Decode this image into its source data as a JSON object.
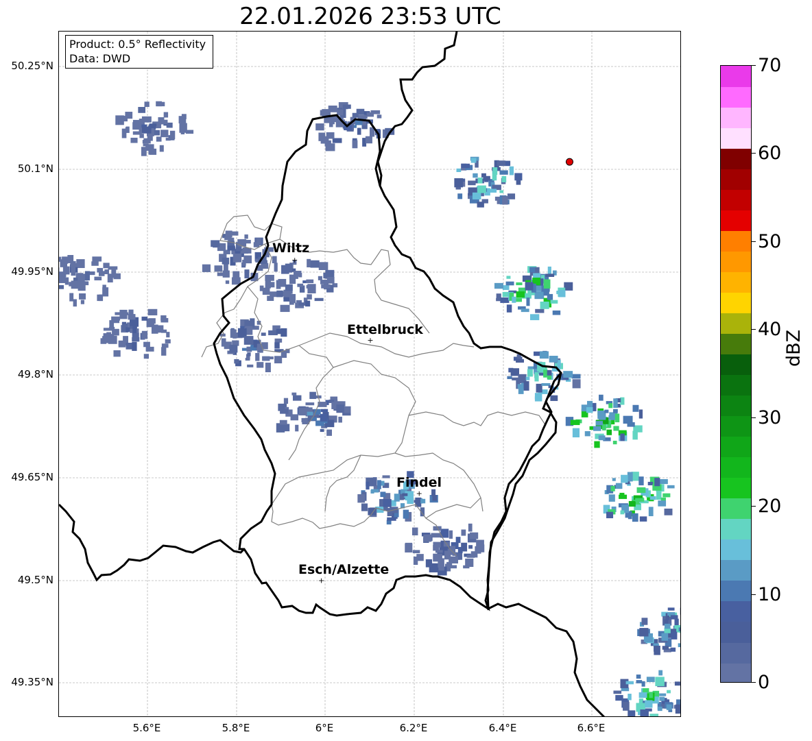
{
  "title": "22.01.2026 23:53 UTC",
  "info_box": {
    "product": "Product: 0.5° Reflectivity",
    "data": "Data: DWD"
  },
  "lat_labels": [
    "50.25°N",
    "50.1°N",
    "49.95°N",
    "49.8°N",
    "49.65°N",
    "49.5°N",
    "49.35°N"
  ],
  "lon_labels": [
    "5.6°E",
    "5.8°E",
    "6°E",
    "6.2°E",
    "6.4°E",
    "6.6°E"
  ],
  "cities": [
    {
      "name": "Wiltz",
      "lon": 5.93,
      "lat": 49.967
    },
    {
      "name": "Ettelbruck",
      "lon": 6.1,
      "lat": 49.85
    },
    {
      "name": "Findel",
      "lon": 6.21,
      "lat": 49.627
    },
    {
      "name": "Esch/Alzette",
      "lon": 5.99,
      "lat": 49.5
    }
  ],
  "radar_site": {
    "lon": 6.548,
    "lat": 50.11,
    "color": "#e00000"
  },
  "colorbar": {
    "unit": "dBZ",
    "min": 0,
    "max": 70,
    "tick_labels": [
      "0",
      "10",
      "20",
      "30",
      "40",
      "50",
      "60",
      "70"
    ],
    "colors": [
      "#6373a4",
      "#56699f",
      "#4a5f9a",
      "#4860a0",
      "#4b79b2",
      "#5a9bc5",
      "#68bfda",
      "#63d5c2",
      "#3fd36f",
      "#17c41f",
      "#12b61c",
      "#10a618",
      "#0e9515",
      "#0c8412",
      "#0a730f",
      "#085f0c",
      "#477b0b",
      "#aab30a",
      "#ffd400",
      "#ffb300",
      "#ff9800",
      "#ff7f00",
      "#e40000",
      "#c20000",
      "#a10000",
      "#800000",
      "#ffe0ff",
      "#ffb6ff",
      "#ff6aff",
      "#ea3aea"
    ]
  },
  "weather_cells": [
    {
      "lon": 5.94,
      "lat": 49.93,
      "dbz": 8
    },
    {
      "lon": 5.8,
      "lat": 49.97,
      "dbz": 7
    },
    {
      "lon": 5.84,
      "lat": 49.84,
      "dbz": 9
    },
    {
      "lon": 5.97,
      "lat": 49.74,
      "dbz": 10
    },
    {
      "lon": 6.16,
      "lat": 49.62,
      "dbz": 16
    },
    {
      "lon": 6.36,
      "lat": 50.08,
      "dbz": 18
    },
    {
      "lon": 6.47,
      "lat": 49.92,
      "dbz": 22
    },
    {
      "lon": 6.63,
      "lat": 49.73,
      "dbz": 25
    },
    {
      "lon": 6.7,
      "lat": 49.62,
      "dbz": 24
    },
    {
      "lon": 6.73,
      "lat": 49.33,
      "dbz": 20
    },
    {
      "lon": 6.78,
      "lat": 49.43,
      "dbz": 18
    },
    {
      "lon": 6.49,
      "lat": 49.8,
      "dbz": 18
    },
    {
      "lon": 5.58,
      "lat": 49.86,
      "dbz": 6
    },
    {
      "lon": 5.45,
      "lat": 49.94,
      "dbz": 6
    },
    {
      "lon": 5.61,
      "lat": 50.16,
      "dbz": 5
    },
    {
      "lon": 6.06,
      "lat": 50.16,
      "dbz": 8
    },
    {
      "lon": 6.27,
      "lat": 49.55,
      "dbz": 9
    }
  ]
}
